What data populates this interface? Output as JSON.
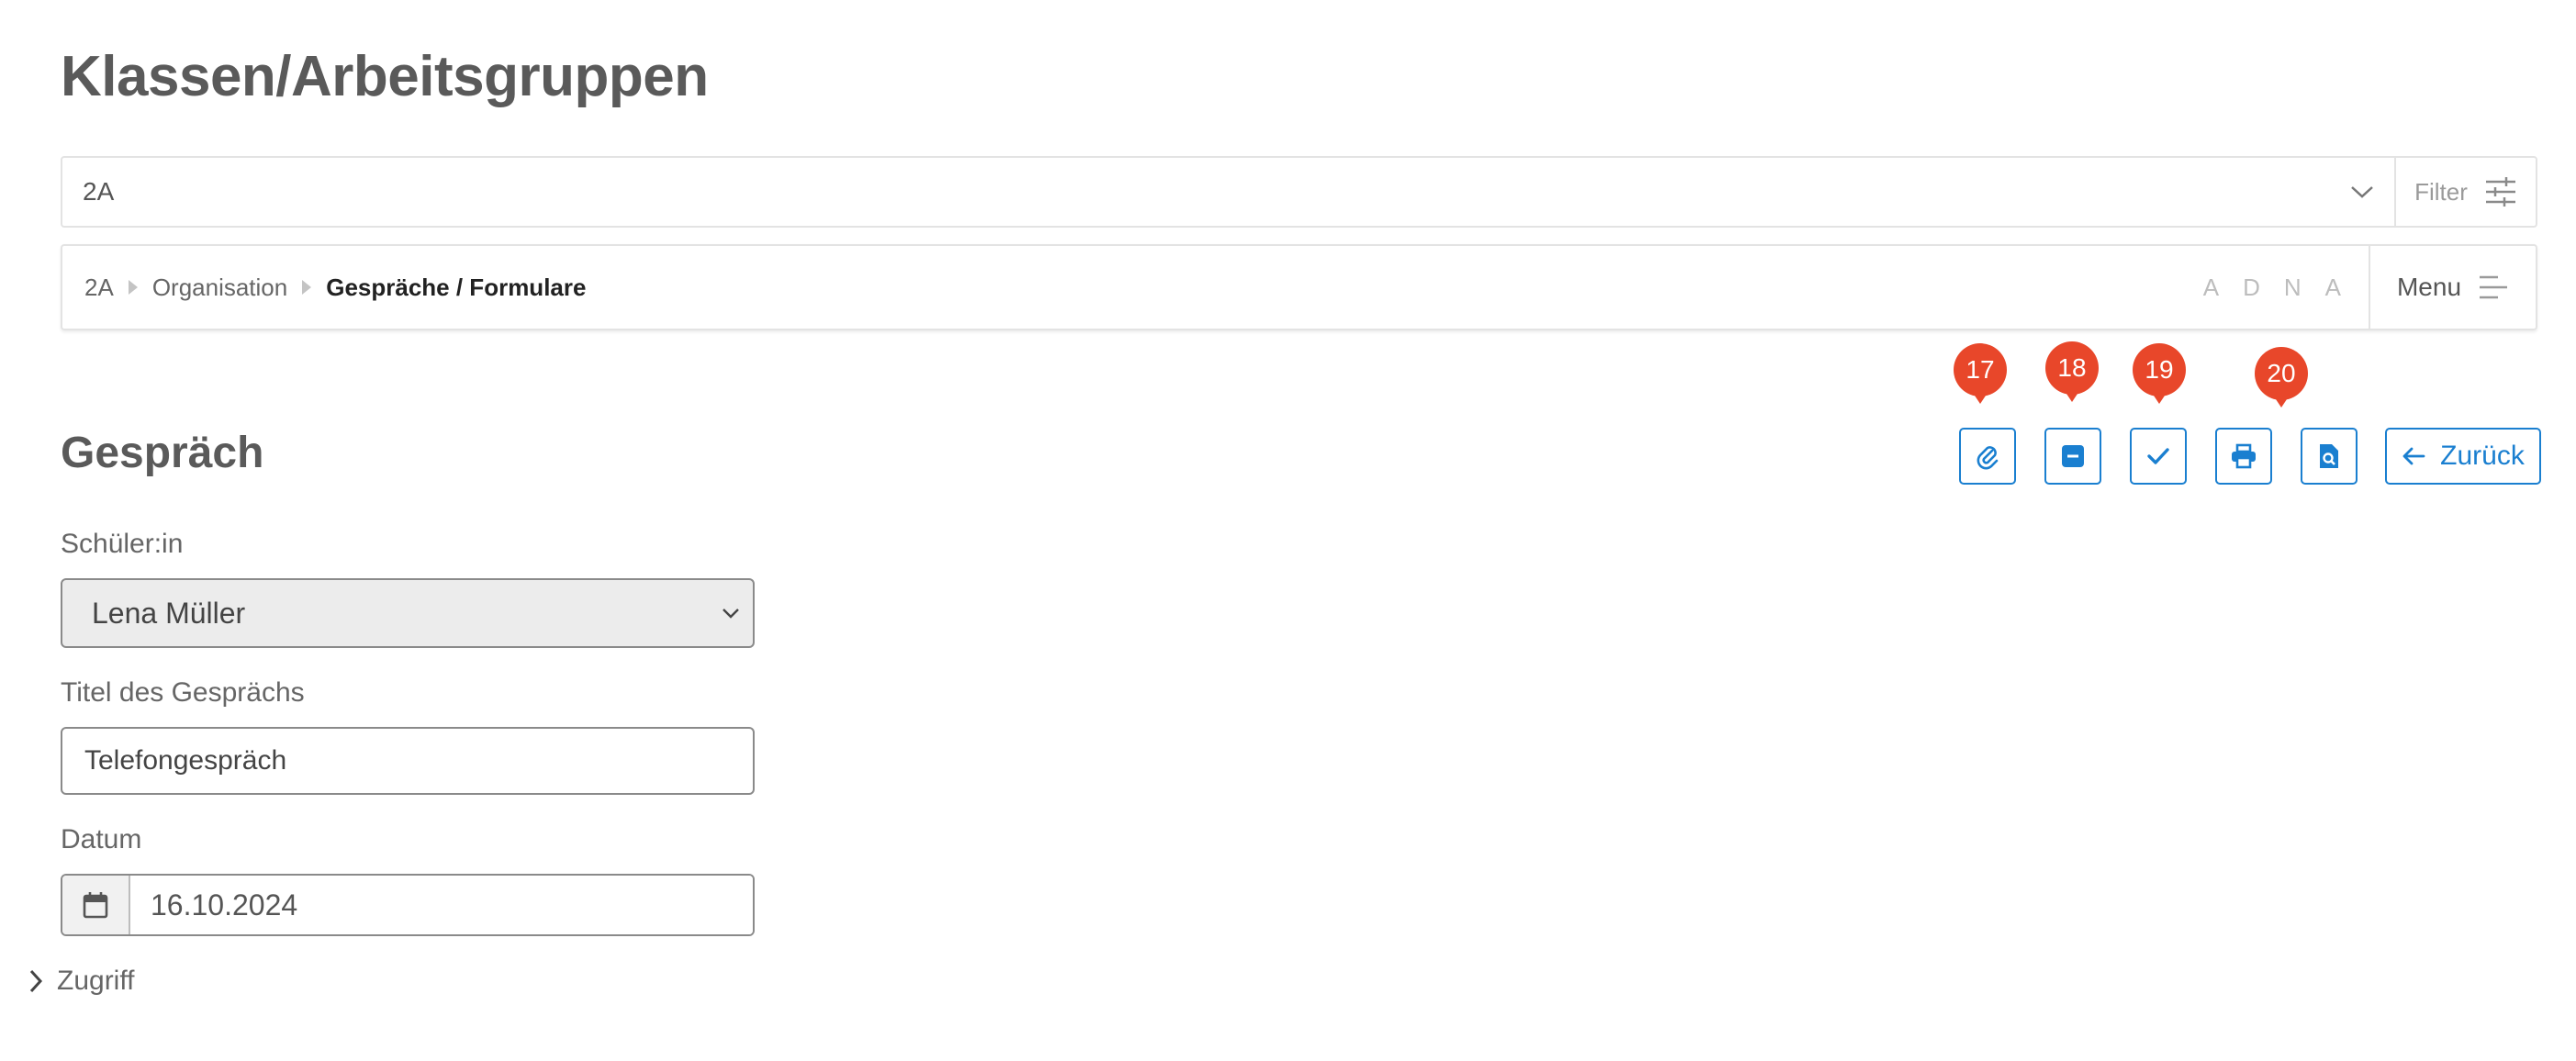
{
  "page": {
    "title": "Klassen/Arbeitsgruppen"
  },
  "class_select": {
    "value": "2A",
    "filter_label": "Filter"
  },
  "breadcrumb": {
    "items": [
      "2A",
      "Organisation"
    ],
    "current": "Gespräche / Formulare",
    "letters": [
      "A",
      "D",
      "N",
      "A"
    ],
    "menu_label": "Menu"
  },
  "section": {
    "title": "Gespräch"
  },
  "toolbar": {
    "buttons": [
      "paperclip-icon",
      "minus-square-icon",
      "check-icon",
      "printer-icon",
      "file-search-icon"
    ],
    "back_label": "Zurück",
    "markers": [
      "17",
      "18",
      "19",
      "20"
    ]
  },
  "form": {
    "student": {
      "label": "Schüler:in",
      "value": "Lena Müller"
    },
    "title": {
      "label": "Titel des Gesprächs",
      "value": "Telefongespräch"
    },
    "date": {
      "label": "Datum",
      "value": "16.10.2024"
    }
  },
  "access": {
    "label": "Zugriff"
  },
  "colors": {
    "accent": "#1a7fd0",
    "marker": "#e8472a",
    "text": "#575757"
  }
}
